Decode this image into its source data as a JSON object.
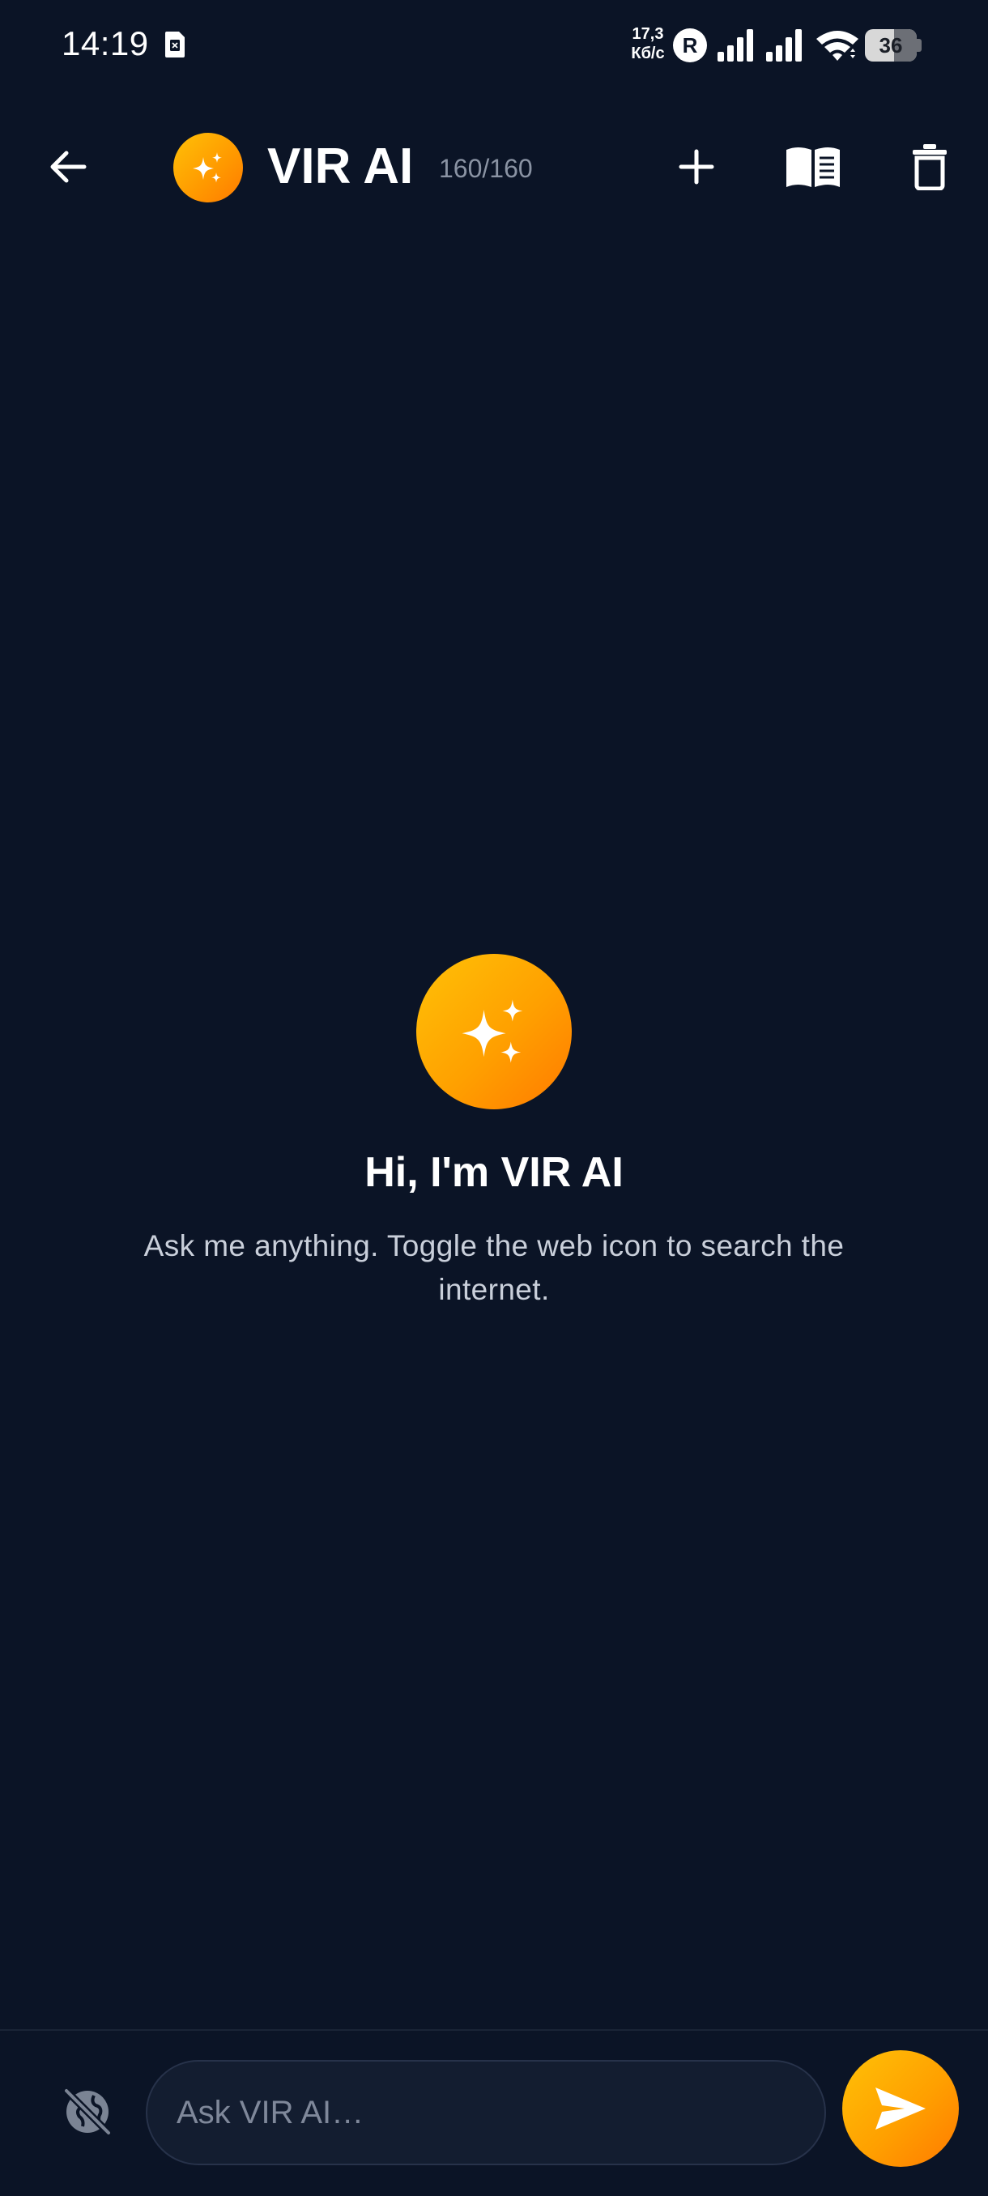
{
  "status_bar": {
    "time": "14:19",
    "net_speed_value": "17,3",
    "net_speed_unit": "Кб/с",
    "battery": "36",
    "sim_icon": "sim-card-icon",
    "roaming_icon": "roaming-r-icon",
    "signal_icon": "cell-signal-icon",
    "wifi_icon": "wifi-icon"
  },
  "app_bar": {
    "title": "VIR AI",
    "counter": "160/160",
    "back_icon": "arrow-left-icon",
    "avatar_icon": "sparkles-icon",
    "new_chat_icon": "plus-icon",
    "library_icon": "open-book-icon",
    "delete_icon": "trash-icon"
  },
  "welcome": {
    "icon": "sparkles-icon",
    "title": "Hi, I'm VIR AI",
    "subtitle": "Ask me anything. Toggle the web icon to search the internet."
  },
  "composer": {
    "web_toggle_icon": "web-off-icon",
    "input_placeholder": "Ask VIR AI…",
    "input_value": "",
    "send_icon": "send-icon"
  },
  "colors": {
    "background": "#0b1426",
    "accent_start": "#ffc107",
    "accent_end": "#ff7a00",
    "input_background": "#131d30",
    "muted_text": "#8a93a3"
  }
}
